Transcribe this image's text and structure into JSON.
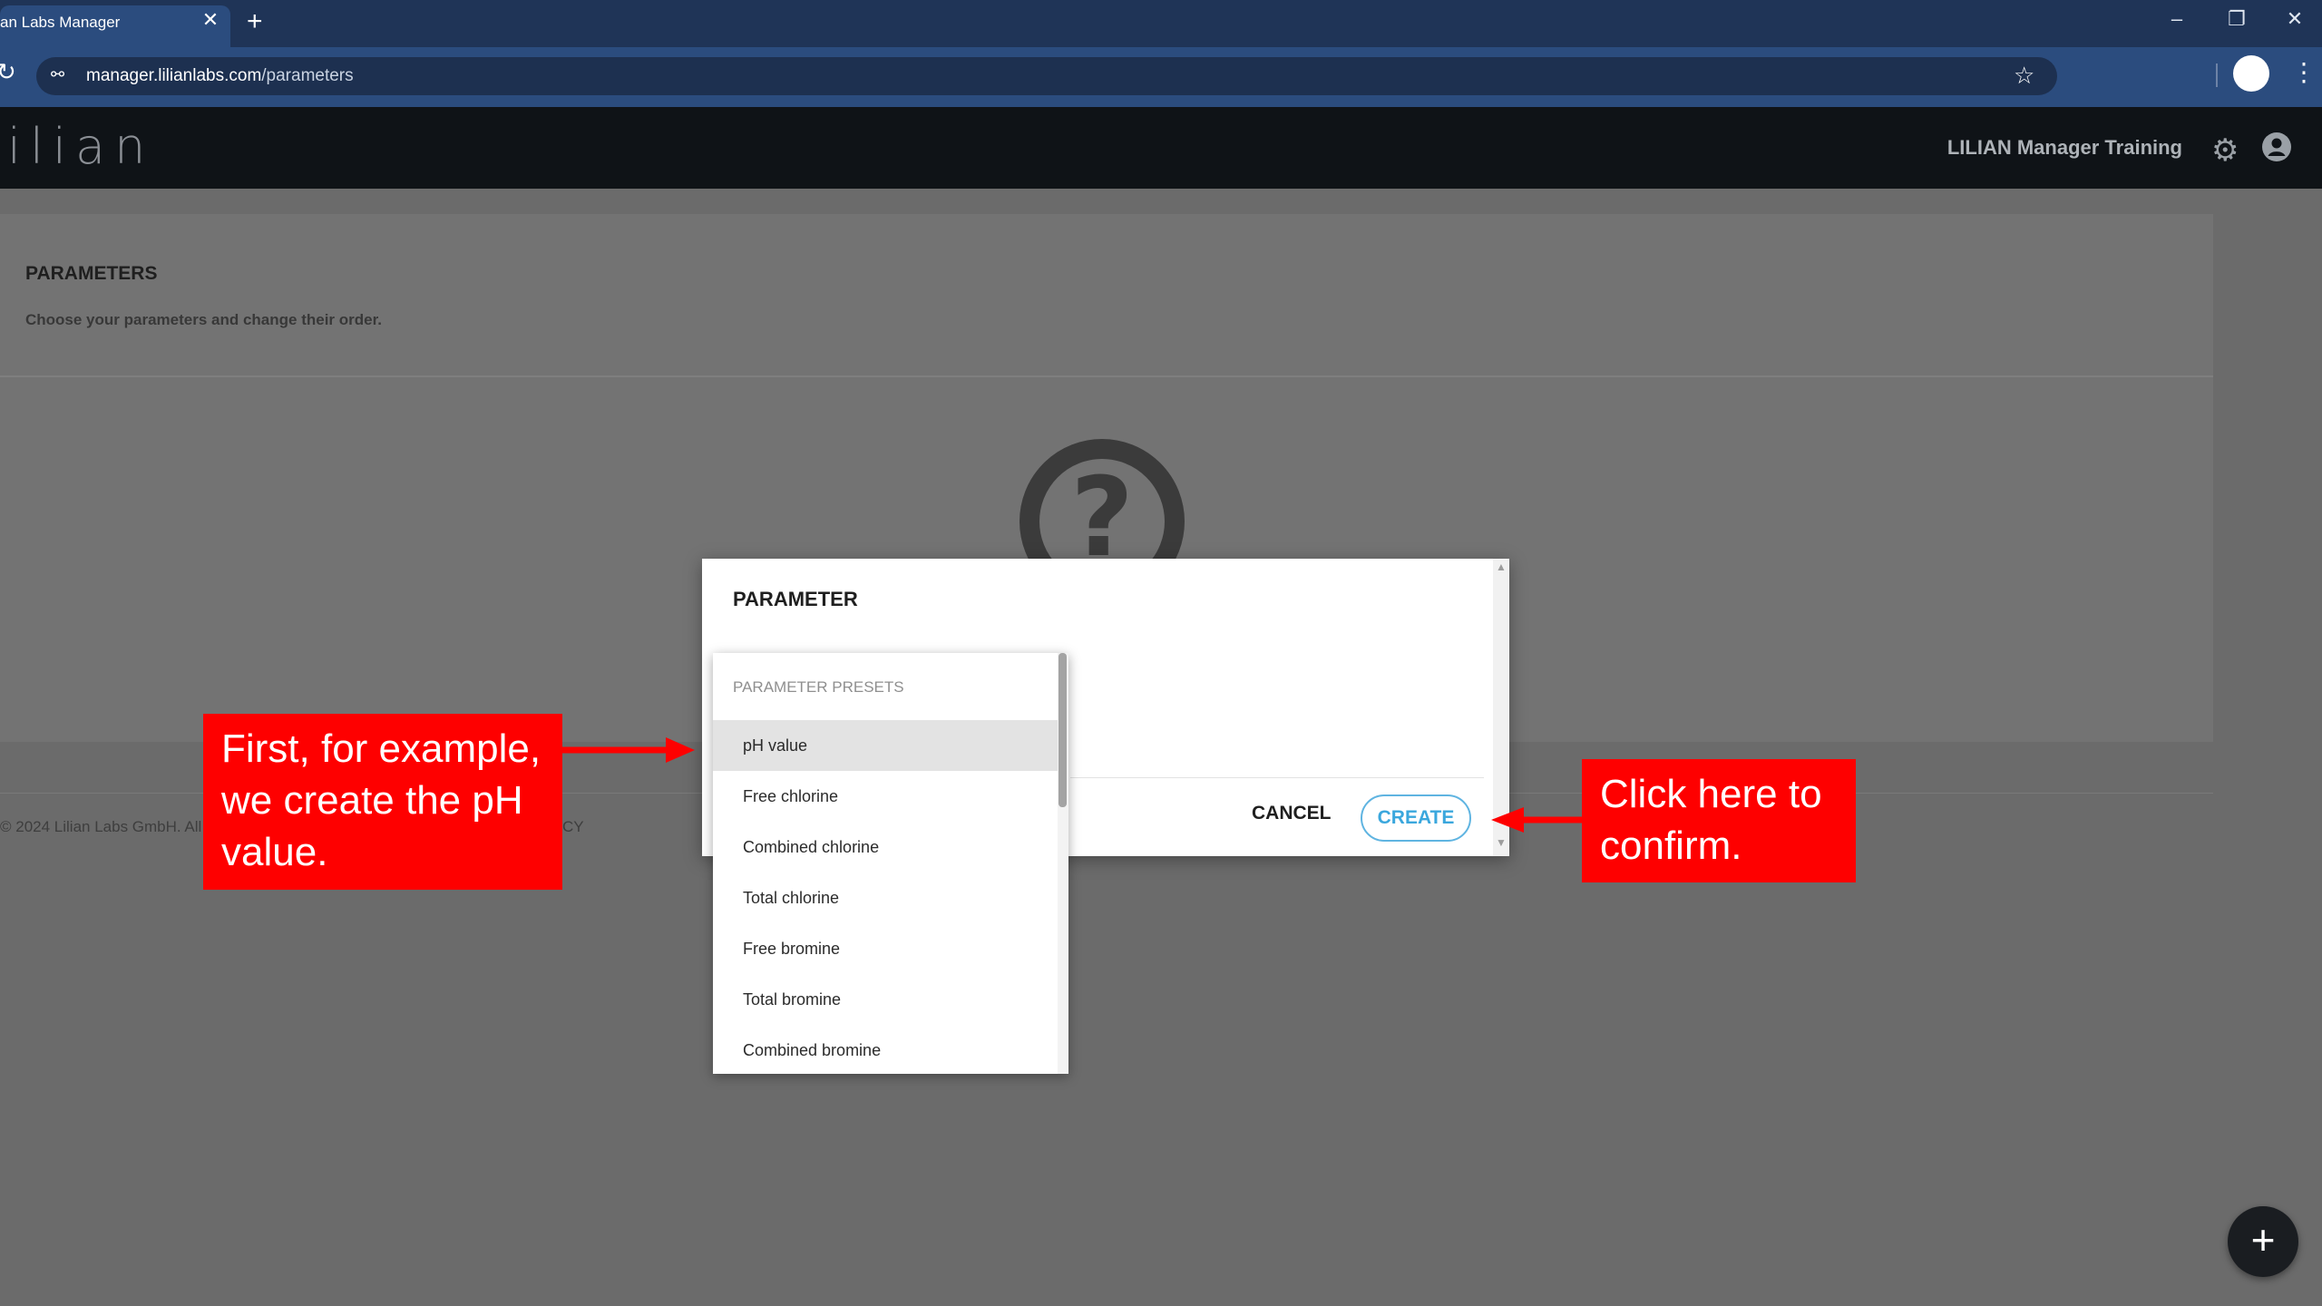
{
  "browser": {
    "tab_title": "an Labs Manager",
    "tab_close": "✕",
    "new_tab": "+",
    "minimize": "–",
    "restore": "❐",
    "close": "✕",
    "reload": "↻",
    "url_host": "manager.lilianlabs.com",
    "url_path": "/parameters",
    "site_info_icon": "⚯",
    "star_icon": "☆",
    "menu_icon": "⋮"
  },
  "header": {
    "logo": "ilian",
    "user": "LILIAN Manager Training",
    "settings_icon": "⚙"
  },
  "page": {
    "title": "PARAMETERS",
    "subtitle": "Choose your parameters and change their order.",
    "help_icon": "?",
    "footer": "© 2024 Lilian Labs GmbH. All",
    "footer_link": "CY"
  },
  "dialog": {
    "title": "PARAMETER",
    "cancel": "CANCEL",
    "create": "CREATE",
    "scroll_up": "▲",
    "scroll_down": "▼"
  },
  "dropdown": {
    "header": "PARAMETER PRESETS",
    "selected_index": 0,
    "items": [
      "pH value",
      "Free chlorine",
      "Combined chlorine",
      "Total chlorine",
      "Free bromine",
      "Total bromine",
      "Combined bromine"
    ]
  },
  "annotations": {
    "left": "First, for example, we create the pH value.",
    "right": "Click here to confirm.",
    "color": "#fe0000"
  },
  "fab": {
    "label": "+"
  }
}
